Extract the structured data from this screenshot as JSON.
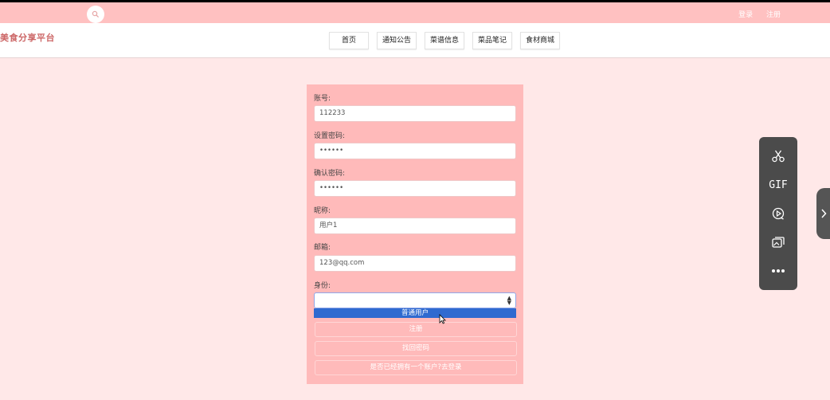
{
  "header": {
    "search_icon": "search-icon",
    "links": {
      "login": "登录",
      "register": "注册"
    }
  },
  "site": {
    "title": "美食分享平台"
  },
  "nav": {
    "items": [
      {
        "label": "首页"
      },
      {
        "label": "通知公告"
      },
      {
        "label": "菜谱信息"
      },
      {
        "label": "菜品笔记"
      },
      {
        "label": "食材商城"
      }
    ]
  },
  "form": {
    "fields": [
      {
        "label": "账号:",
        "value": "112233"
      },
      {
        "label": "设置密码:",
        "value": "••••••"
      },
      {
        "label": "确认密码:",
        "value": "••••••"
      },
      {
        "label": "昵称:",
        "value": "用户1"
      },
      {
        "label": "邮箱:",
        "value": "123@qq.com"
      }
    ],
    "role": {
      "label": "身份:",
      "selected": "",
      "options": [
        "普通用户"
      ]
    },
    "buttons": {
      "register": "注册",
      "find_password": "找回密码",
      "go_login": "是否已经拥有一个账户?去登录"
    }
  },
  "side_toolbar": {
    "tools": [
      "scissors-icon",
      "GIF",
      "record-icon",
      "image-icon",
      "more-icon"
    ],
    "gif_label": "GIF"
  },
  "colors": {
    "page_bg": "#ffe8e8",
    "topbar_bg": "#ffc1c1",
    "card_bg": "#ffbaba",
    "title_color": "#cc6666",
    "dropdown_highlight": "#2f6ad0",
    "side_panel_bg": "#4b4b4b"
  }
}
